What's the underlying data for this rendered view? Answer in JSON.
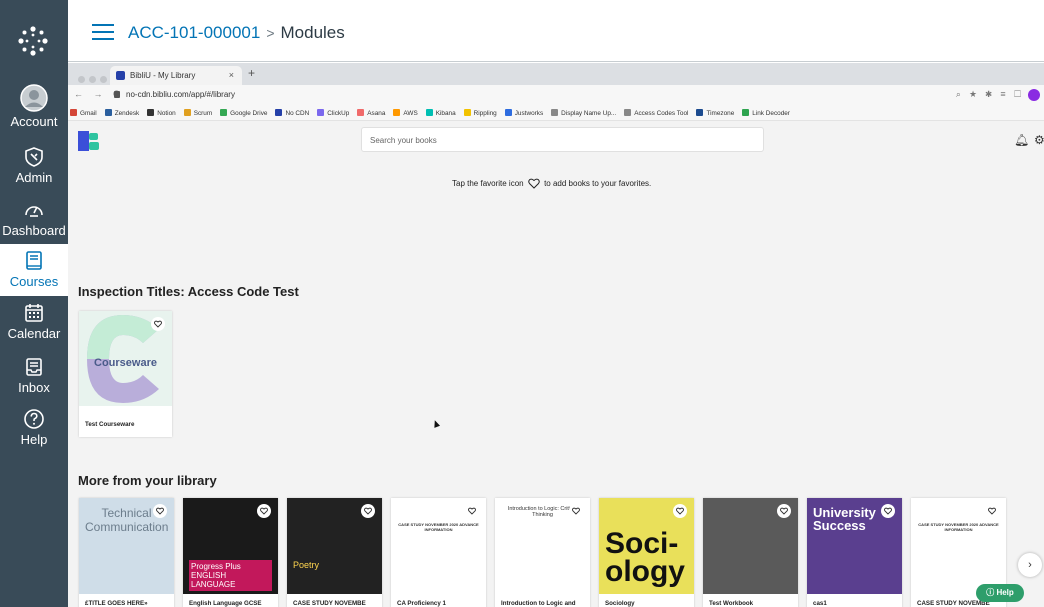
{
  "global_nav": {
    "items": [
      {
        "label": "Account",
        "icon": "user-avatar-icon"
      },
      {
        "label": "Admin",
        "icon": "shield-icon"
      },
      {
        "label": "Dashboard",
        "icon": "dashboard-gauge-icon"
      },
      {
        "label": "Courses",
        "icon": "book-icon",
        "active": true
      },
      {
        "label": "Calendar",
        "icon": "calendar-icon"
      },
      {
        "label": "Inbox",
        "icon": "inbox-icon"
      },
      {
        "label": "Help",
        "icon": "question-icon"
      }
    ]
  },
  "header": {
    "course": "ACC-101-000001",
    "separator": ">",
    "page": "Modules"
  },
  "browser": {
    "tab_title": "BibliU - My Library",
    "tab_close": "×",
    "new_tab": "+",
    "url": "no-cdn.bibliu.com/app/#/library",
    "bookmarks": [
      {
        "label": "Gmail",
        "color": "#d44638"
      },
      {
        "label": "Zendesk",
        "color": "#2b5f9e"
      },
      {
        "label": "Notion",
        "color": "#333333"
      },
      {
        "label": "Scrum",
        "color": "#e0a020"
      },
      {
        "label": "Google Drive",
        "color": "#34a853"
      },
      {
        "label": "No CDN",
        "color": "#2540a8"
      },
      {
        "label": "ClickUp",
        "color": "#7b68ee"
      },
      {
        "label": "Asana",
        "color": "#f06a6a"
      },
      {
        "label": "AWS",
        "color": "#ff9900"
      },
      {
        "label": "Kibana",
        "color": "#00bfb3"
      },
      {
        "label": "Rippling",
        "color": "#f2c200"
      },
      {
        "label": "Justworks",
        "color": "#2d6cdf"
      },
      {
        "label": "Display Name Up...",
        "color": "#888888"
      },
      {
        "label": "Access Codes Tool",
        "color": "#888888"
      },
      {
        "label": "Timezone",
        "color": "#1c4b8f"
      },
      {
        "label": "Link Decoder",
        "color": "#2ea44f"
      }
    ]
  },
  "library": {
    "search_placeholder": "Search your books",
    "favorite_tip_before": "Tap the favorite icon",
    "favorite_tip_after": "to add books to your favorites.",
    "inspection_heading": "Inspection Titles: Access Code Test",
    "courseware_cover_text": "Courseware",
    "courseware_title": "Test Courseware",
    "more_heading": "More from your library",
    "books": [
      {
        "title": "£TITLE GOES HERE»",
        "cover_text": "Technical Communication",
        "bg": "#cfdde8"
      },
      {
        "title": "English Language GCSE",
        "cover_text": "Progress Plus ENGLISH LANGUAGE",
        "bg": "#1a1a1a"
      },
      {
        "title": "CASE STUDY NOVEMBE",
        "cover_text": "Poetry",
        "bg": "#222222"
      },
      {
        "title": "CA Proficiency 1",
        "cover_text": "CASE STUDY NOVEMBER 2020 ADVANCE INFORMATION",
        "bg": "#ffffff"
      },
      {
        "title": "Introduction to Logic and",
        "cover_text": "Introduction to Logic: Critical Thinking",
        "bg": "#ffffff"
      },
      {
        "title": "Sociology",
        "cover_text": "Soci- ology",
        "bg": "#e9e05a"
      },
      {
        "title": "Test Workbook",
        "cover_text": "",
        "bg": "#5a5a5a"
      },
      {
        "title": "cas1",
        "cover_text": "University Success",
        "bg": "#5a3f8f"
      },
      {
        "title": "CASE STUDY NOVEMBE",
        "cover_text": "CASE STUDY NOVEMBER 2020 ADVANCE INFORMATION",
        "bg": "#ffffff"
      }
    ],
    "help_label": "Help",
    "next_label": "›"
  }
}
